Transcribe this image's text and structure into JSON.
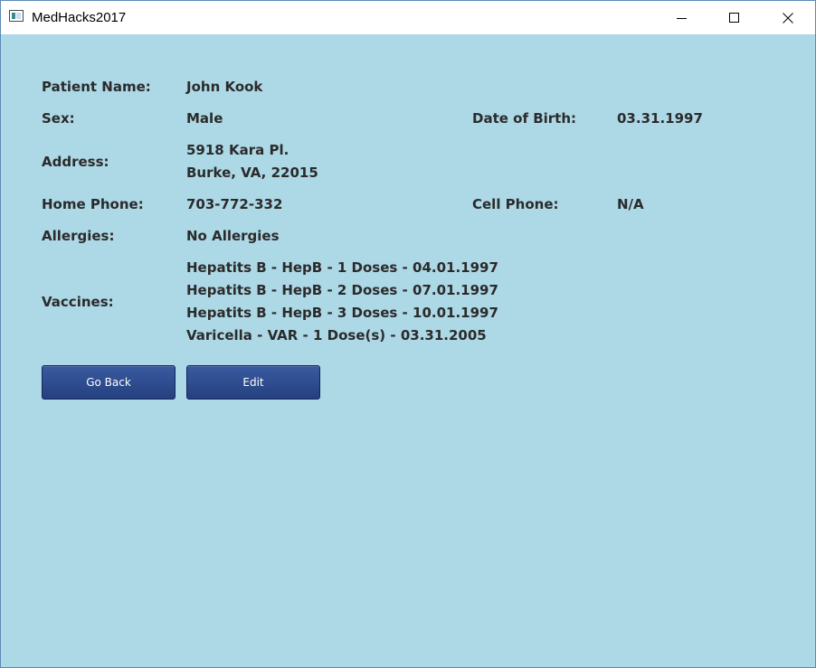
{
  "window": {
    "title": "MedHacks2017",
    "controls": {
      "minimize_icon": "minimize-icon",
      "maximize_icon": "maximize-icon",
      "close_icon": "close-icon"
    }
  },
  "patient": {
    "name_label": "Patient Name:",
    "name": "John Kook",
    "sex_label": "Sex:",
    "sex": "Male",
    "dob_label": "Date of Birth:",
    "dob": "03.31.1997",
    "address_label": "Address:",
    "address_line1": "5918 Kara Pl.",
    "address_line2": "Burke, VA, 22015",
    "home_phone_label": "Home Phone:",
    "home_phone": "703-772-332",
    "cell_phone_label": "Cell Phone:",
    "cell_phone": "N/A",
    "allergies_label": "Allergies:",
    "allergies": "No Allergies",
    "vaccines_label": "Vaccines:",
    "vaccines": [
      "Hepatits B - HepB - 1 Doses - 04.01.1997",
      "Hepatits B - HepB - 2 Doses - 07.01.1997",
      "Hepatits B - HepB - 3 Doses - 10.01.1997",
      "Varicella - VAR - 1 Dose(s) - 03.31.2005"
    ]
  },
  "buttons": {
    "go_back": "Go Back",
    "edit": "Edit"
  },
  "colors": {
    "background": "#add8e6",
    "button": "#2d4a8a",
    "text": "#2b2b2b"
  }
}
